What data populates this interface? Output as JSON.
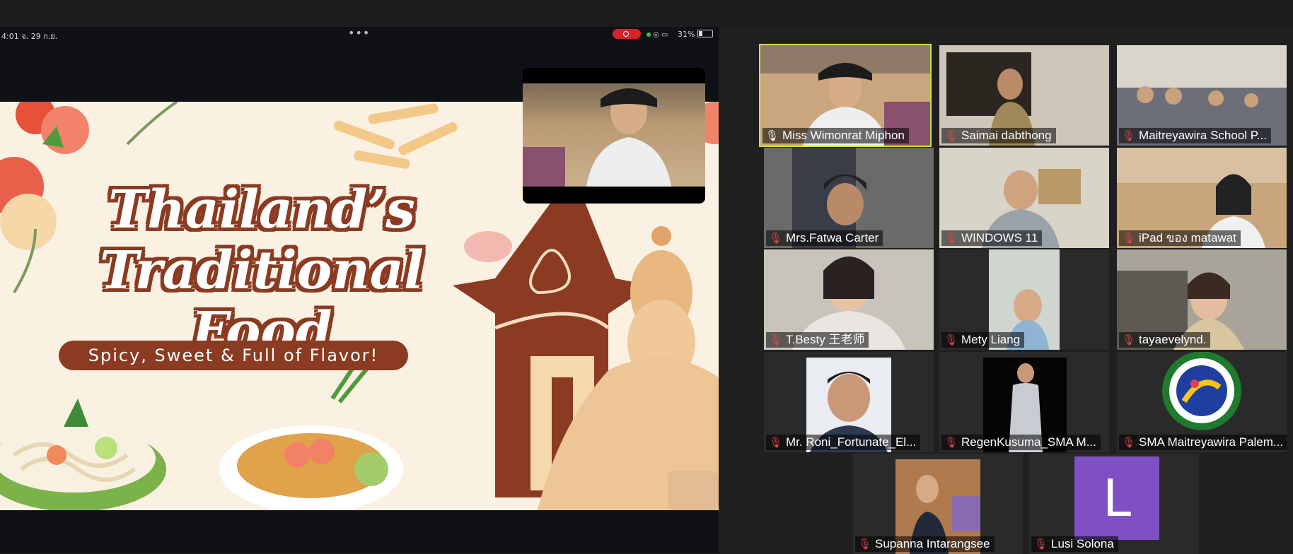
{
  "ipad_status": {
    "time": "4:01  จ. 29 ก.ย.",
    "more": "•••",
    "battery": "31%"
  },
  "slide": {
    "title_line1": "Thailand’s",
    "title_line2": "Traditional Food",
    "subtitle": "Spicy, Sweet & Full of Flavor!"
  },
  "participants": [
    {
      "name": "Miss Wimonrat Miphon",
      "mic": "unmuted"
    },
    {
      "name": "Saimai dabthong",
      "mic": "muted"
    },
    {
      "name": "Maitreyawira School P...",
      "mic": "muted"
    },
    {
      "name": "Mrs.Fatwa Carter",
      "mic": "muted"
    },
    {
      "name": "WINDOWS 11",
      "mic": "muted"
    },
    {
      "name": "iPad ของ matawat",
      "mic": "muted"
    },
    {
      "name": "T.Besty 王老师",
      "mic": "muted"
    },
    {
      "name": "Mety Liang",
      "mic": "muted"
    },
    {
      "name": "tayaevelynd.",
      "mic": "muted"
    },
    {
      "name": "Mr. Roni_Fortunate_El...",
      "mic": "muted"
    },
    {
      "name": "RegenKusuma_SMA M...",
      "mic": "muted"
    },
    {
      "name": "SMA Maitreyawira Palem...",
      "mic": "muted"
    },
    {
      "name": "Supanna Intarangsee",
      "mic": "muted"
    },
    {
      "name": "Lusi Solona",
      "mic": "muted",
      "avatar_letter": "L"
    }
  ],
  "colors": {
    "active_speaker": "#c8e34a",
    "muted_mic": "#e0444a",
    "slide_brown": "#8a3b22",
    "avatar_purple": "#7f4fc4"
  }
}
